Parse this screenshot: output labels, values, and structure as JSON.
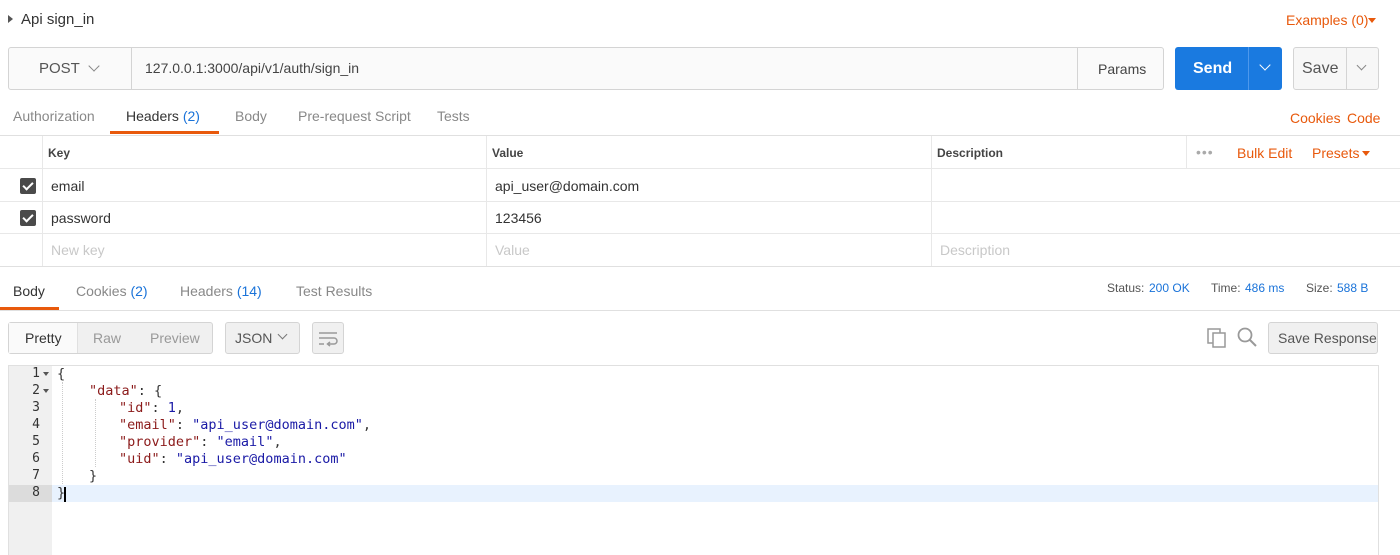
{
  "request": {
    "title": "Api sign_in",
    "examples_label": "Examples (0)",
    "method": "POST",
    "url": "127.0.0.1:3000/api/v1/auth/sign_in",
    "params_label": "Params",
    "send_label": "Send",
    "save_label": "Save"
  },
  "request_tabs": {
    "authorization": "Authorization",
    "headers": "Headers",
    "headers_count": "(2)",
    "body": "Body",
    "pre_request": "Pre-request Script",
    "tests": "Tests",
    "cookies": "Cookies",
    "code": "Code"
  },
  "headers_table": {
    "col_key": "Key",
    "col_value": "Value",
    "col_description": "Description",
    "dots": "•••",
    "bulk_edit": "Bulk Edit",
    "presets": "Presets",
    "rows": [
      {
        "checked": true,
        "key": "email",
        "value": "api_user@domain.com"
      },
      {
        "checked": true,
        "key": "password",
        "value": "123456"
      }
    ],
    "new_key_placeholder": "New key",
    "value_placeholder": "Value",
    "description_placeholder": "Description"
  },
  "response_tabs": {
    "body": "Body",
    "cookies": "Cookies",
    "cookies_count": "(2)",
    "headers": "Headers",
    "headers_count": "(14)",
    "test_results": "Test Results"
  },
  "response_meta": {
    "status_label": "Status:",
    "status_value": "200 OK",
    "time_label": "Time:",
    "time_value": "486 ms",
    "size_label": "Size:",
    "size_value": "588 B"
  },
  "response_toolbar": {
    "pretty": "Pretty",
    "raw": "Raw",
    "preview": "Preview",
    "format": "JSON",
    "save_response": "Save Response"
  },
  "editor": {
    "line_numbers": [
      "1",
      "2",
      "3",
      "4",
      "5",
      "6",
      "7",
      "8"
    ],
    "lines": {
      "l1": "{",
      "l2_key": "\"data\"",
      "l2_rest": ": {",
      "l3_key": "\"id\"",
      "l3_sep": ": ",
      "l3_val": "1",
      "l3_end": ",",
      "l4_key": "\"email\"",
      "l4_sep": ": ",
      "l4_val": "\"api_user@domain.com\"",
      "l4_end": ",",
      "l5_key": "\"provider\"",
      "l5_sep": ": ",
      "l5_val": "\"email\"",
      "l5_end": ",",
      "l6_key": "\"uid\"",
      "l6_sep": ": ",
      "l6_val": "\"api_user@domain.com\"",
      "l7": "}",
      "l8": "}"
    }
  }
}
